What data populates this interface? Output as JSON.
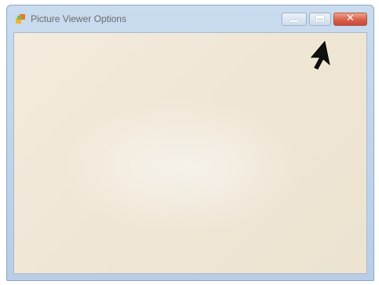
{
  "window": {
    "title": "Picture Viewer Options"
  },
  "icons": {
    "app": "app-icon",
    "minimize": "minimize-icon",
    "maximize": "maximize-icon",
    "close": "close-icon",
    "cursor": "mouse-pointer-icon"
  },
  "colors": {
    "title_bar": "#c3d6ec",
    "close_button": "#d9604a",
    "client_area": "#efe6d5"
  }
}
